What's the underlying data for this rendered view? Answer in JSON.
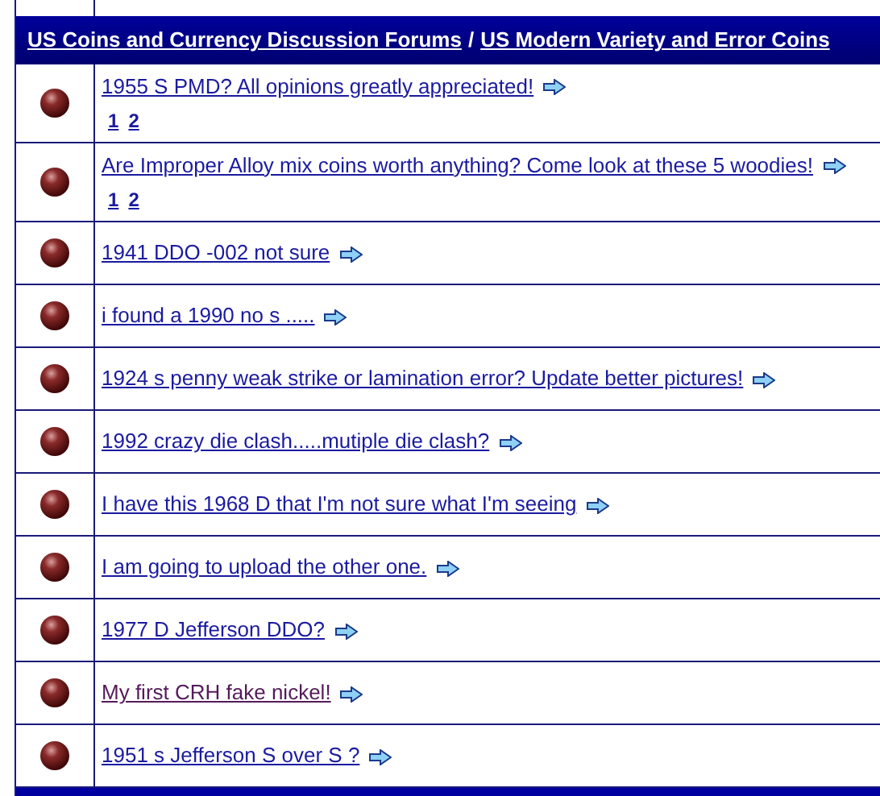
{
  "breadcrumb": [
    {
      "label": "US Coins and Currency Discussion Forums"
    },
    {
      "label": "US Modern Variety and Error Coins"
    }
  ],
  "breadcrumb_separator": "/",
  "topics": [
    {
      "title": "1955 S PMD? All opinions greatly appreciated!",
      "visited": false,
      "pages": [
        "1",
        "2"
      ]
    },
    {
      "title": "Are Improper Alloy mix coins worth anything? Come look at these 5 woodies!",
      "visited": false,
      "pages": [
        "1",
        "2"
      ]
    },
    {
      "title": "1941 DDO -002 not sure",
      "visited": false
    },
    {
      "title": "i found a 1990 no s .....",
      "visited": false
    },
    {
      "title": "1924 s penny weak strike or lamination error? Update better pictures!",
      "visited": false
    },
    {
      "title": "1992 crazy die clash.....mutiple die clash?",
      "visited": false
    },
    {
      "title": "I have this 1968 D that I'm not sure what I'm seeing",
      "visited": false
    },
    {
      "title": "I am going to upload the other one.",
      "visited": false
    },
    {
      "title": "1977 D Jefferson DDO?",
      "visited": false
    },
    {
      "title": "My first CRH fake nickel!",
      "visited": true
    },
    {
      "title": "1951 s Jefferson S over S ?",
      "visited": false
    }
  ]
}
